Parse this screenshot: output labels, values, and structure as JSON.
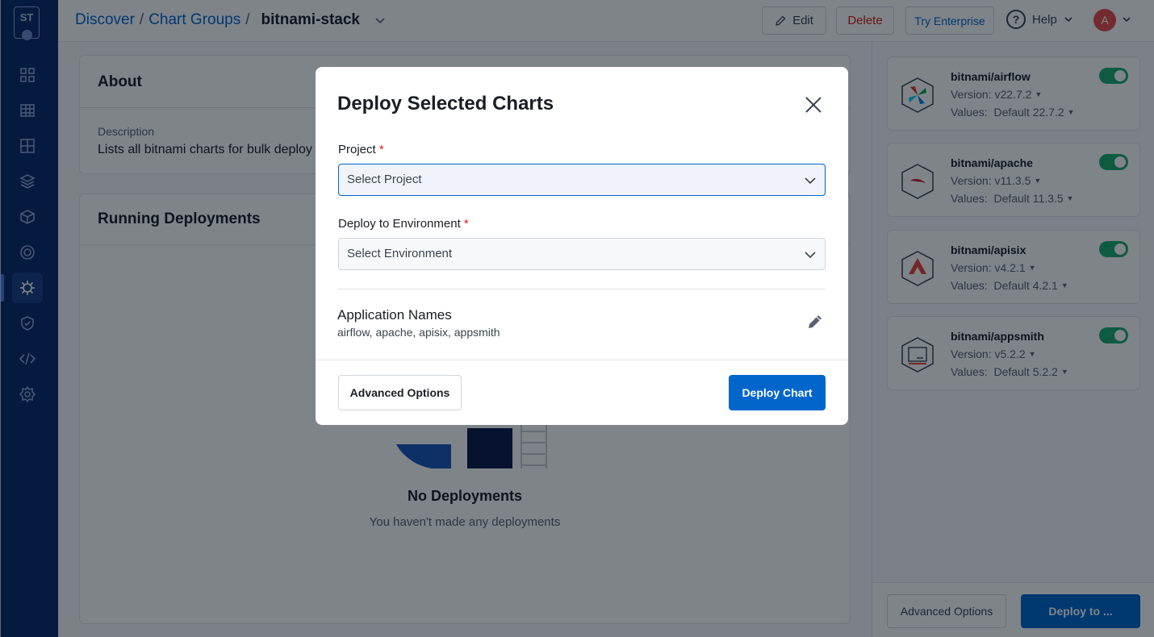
{
  "sidebar": {
    "logo_text": "ST",
    "items": [
      {
        "icon": "grid-icon"
      },
      {
        "icon": "table-icon"
      },
      {
        "icon": "apps-icon"
      },
      {
        "icon": "layers-icon"
      },
      {
        "icon": "cube-icon"
      },
      {
        "icon": "target-icon"
      },
      {
        "icon": "helm-icon",
        "active": true
      },
      {
        "icon": "shield-icon"
      },
      {
        "icon": "code-icon"
      },
      {
        "icon": "gear-icon"
      }
    ]
  },
  "header": {
    "breadcrumb": [
      {
        "label": "Discover"
      },
      {
        "label": "/"
      },
      {
        "label": "Chart Groups"
      },
      {
        "label": "/"
      }
    ],
    "current": "bitnami-stack",
    "edit_label": "Edit",
    "delete_label": "Delete",
    "enterprise_label": "Try Enterprise",
    "help_label": "Help",
    "help_glyph": "?",
    "avatar_initial": "A"
  },
  "about": {
    "title": "About",
    "description_label": "Description",
    "description_value": "Lists all bitnami charts for bulk deploy"
  },
  "deployments": {
    "title": "Running Deployments",
    "empty_title": "No Deployments",
    "empty_subtitle": "You haven't made any deployments"
  },
  "charts": [
    {
      "name": "bitnami/airflow",
      "version_label": "Version:",
      "version": "v22.7.2",
      "values_label": "Values:",
      "values": "Default 22.7.2",
      "icon": "airflow-icon",
      "enabled": true
    },
    {
      "name": "bitnami/apache",
      "version_label": "Version:",
      "version": "v11.3.5",
      "values_label": "Values:",
      "values": "Default 11.3.5",
      "icon": "apache-icon",
      "enabled": true
    },
    {
      "name": "bitnami/apisix",
      "version_label": "Version:",
      "version": "v4.2.1",
      "values_label": "Values:",
      "values": "Default 4.2.1",
      "icon": "apisix-icon",
      "enabled": true
    },
    {
      "name": "bitnami/appsmith",
      "version_label": "Version:",
      "version": "v5.2.2",
      "values_label": "Values:",
      "values": "Default 5.2.2",
      "icon": "appsmith-icon",
      "enabled": true
    }
  ],
  "right_footer": {
    "advanced_label": "Advanced Options",
    "deploy_label": "Deploy to ..."
  },
  "modal": {
    "title": "Deploy Selected Charts",
    "project_label": "Project",
    "required_mark": "*",
    "project_placeholder": "Select Project",
    "env_label": "Deploy to Environment",
    "env_placeholder": "Select Environment",
    "app_names_label": "Application Names",
    "app_names_value": "airflow, apache, apisix, appsmith",
    "advanced_label": "Advanced Options",
    "deploy_label": "Deploy Chart"
  },
  "colors": {
    "sidebar_bg": "#0b2a6b",
    "primary": "#0066cc",
    "danger": "#d6201a",
    "toggle_on": "#1dad70"
  }
}
